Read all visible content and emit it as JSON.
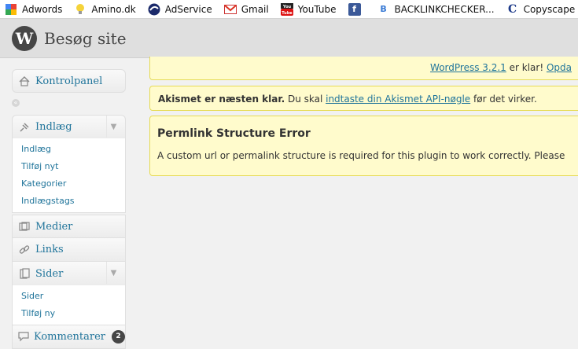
{
  "bookmarks": [
    {
      "label": "Adwords",
      "icon": "google-icon"
    },
    {
      "label": "Amino.dk",
      "icon": "lightbulb-icon"
    },
    {
      "label": "AdService",
      "icon": "adservice-icon"
    },
    {
      "label": "Gmail",
      "icon": "gmail-icon"
    },
    {
      "label": "YouTube",
      "icon": "youtube-icon"
    },
    {
      "label": "",
      "icon": "facebook-icon"
    },
    {
      "label": "BACKLINKCHECKER...",
      "icon": "backlinkchecker-icon"
    },
    {
      "label": "Copyscape Plagiaris...",
      "icon": "copyscape-icon"
    }
  ],
  "header": {
    "site_title": "Besøg site"
  },
  "menu": {
    "dashboard": "Kontrolpanel",
    "posts": {
      "label": "Indlæg",
      "items": [
        "Indlæg",
        "Tilføj nyt",
        "Kategorier",
        "Indlægstags"
      ]
    },
    "media": "Medier",
    "links": "Links",
    "pages": {
      "label": "Sider",
      "items": [
        "Sider",
        "Tilføj ny"
      ]
    },
    "comments": {
      "label": "Kommentarer",
      "count": "2"
    }
  },
  "notices": {
    "update": {
      "link": "WordPress 3.2.1",
      "text": " er klar! ",
      "link2": "Opda"
    },
    "akismet": {
      "bold": "Akismet er næsten klar.",
      "text1": " Du skal ",
      "link": "indtaste din Akismet API-nøgle",
      "text2": " før det virker."
    },
    "permalink": {
      "title": "Permlink Structure Error",
      "text": "A custom url or permalink structure is required for this plugin to work correctly. Please"
    }
  },
  "colors": {
    "link": "#21759b",
    "notice_bg": "#fffbcc",
    "notice_border": "#e6db55"
  }
}
